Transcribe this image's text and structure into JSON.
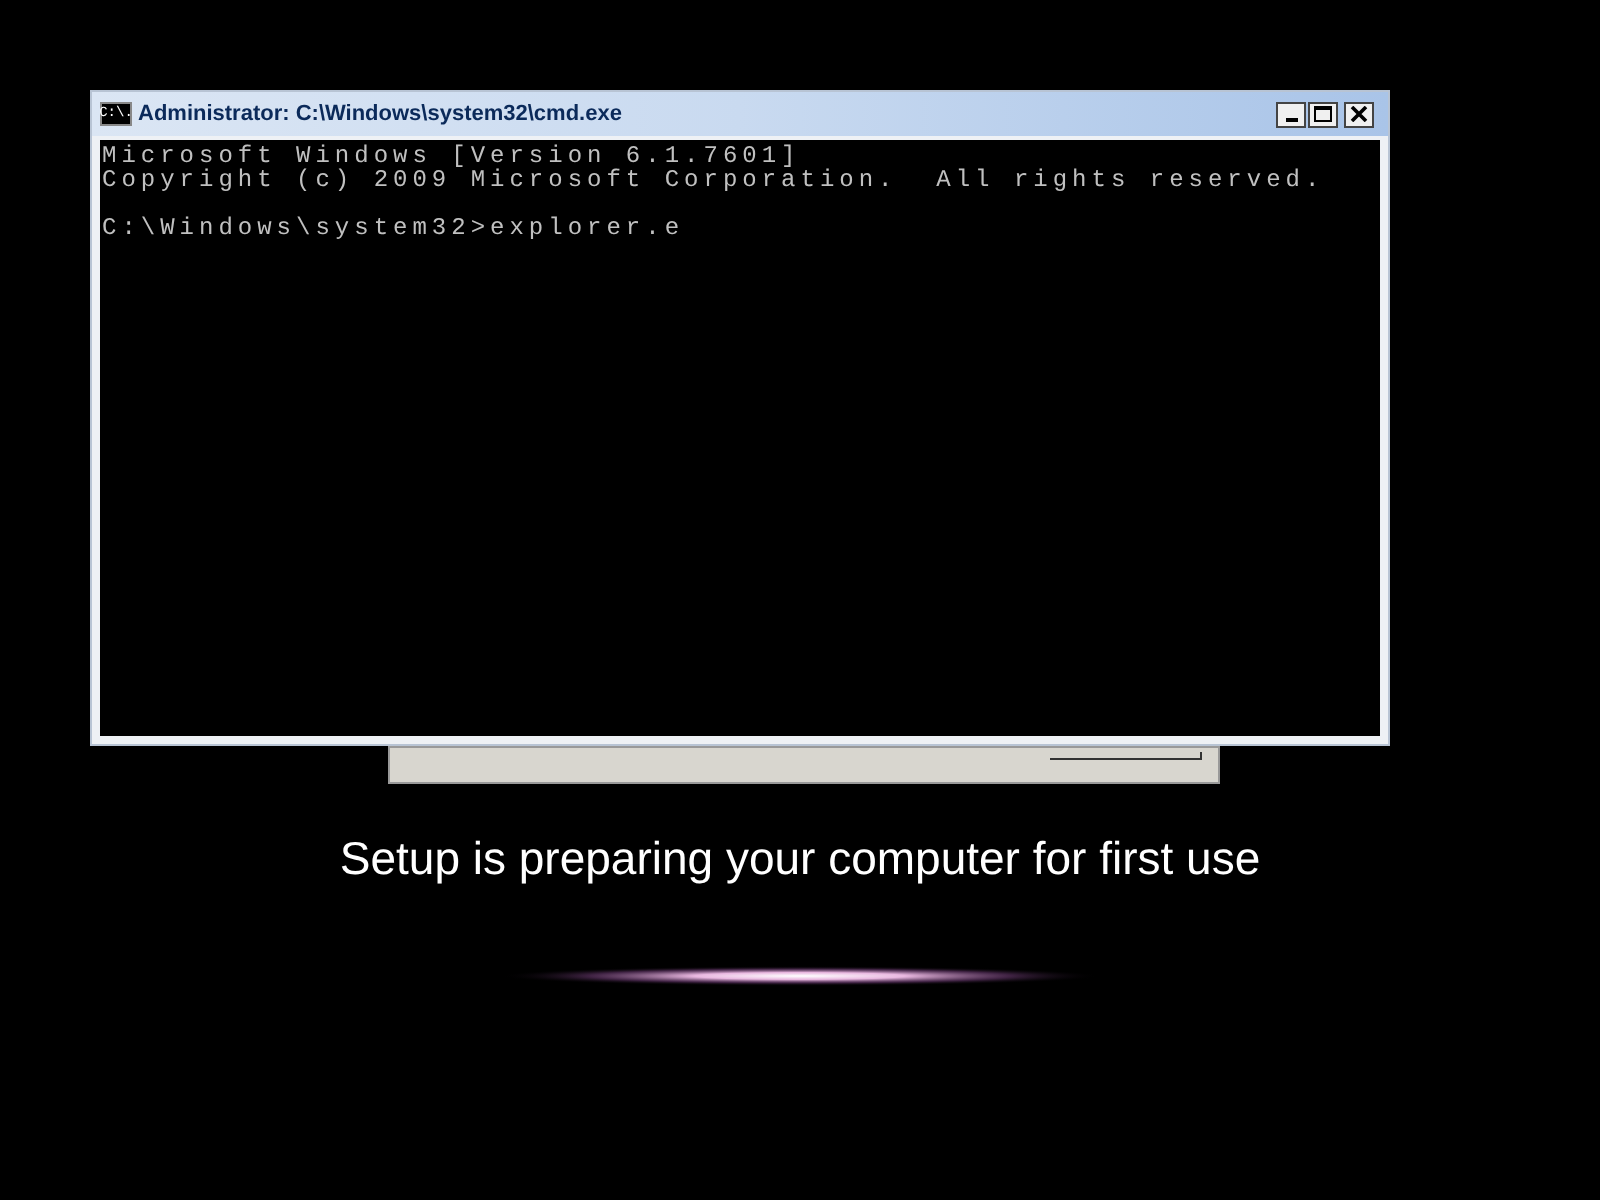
{
  "window": {
    "title": "Administrator: C:\\Windows\\system32\\cmd.exe",
    "icon_text": "C:\\.",
    "paragraphs": [
      [
        "Microsoft Windows [Version 6.1.7601]",
        "Copyright (c) 2009 Microsoft Corporation.  All rights reserved."
      ],
      [
        "C:\\Windows\\system32>explorer.e"
      ]
    ]
  },
  "message": "Setup is preparing your computer for first use"
}
